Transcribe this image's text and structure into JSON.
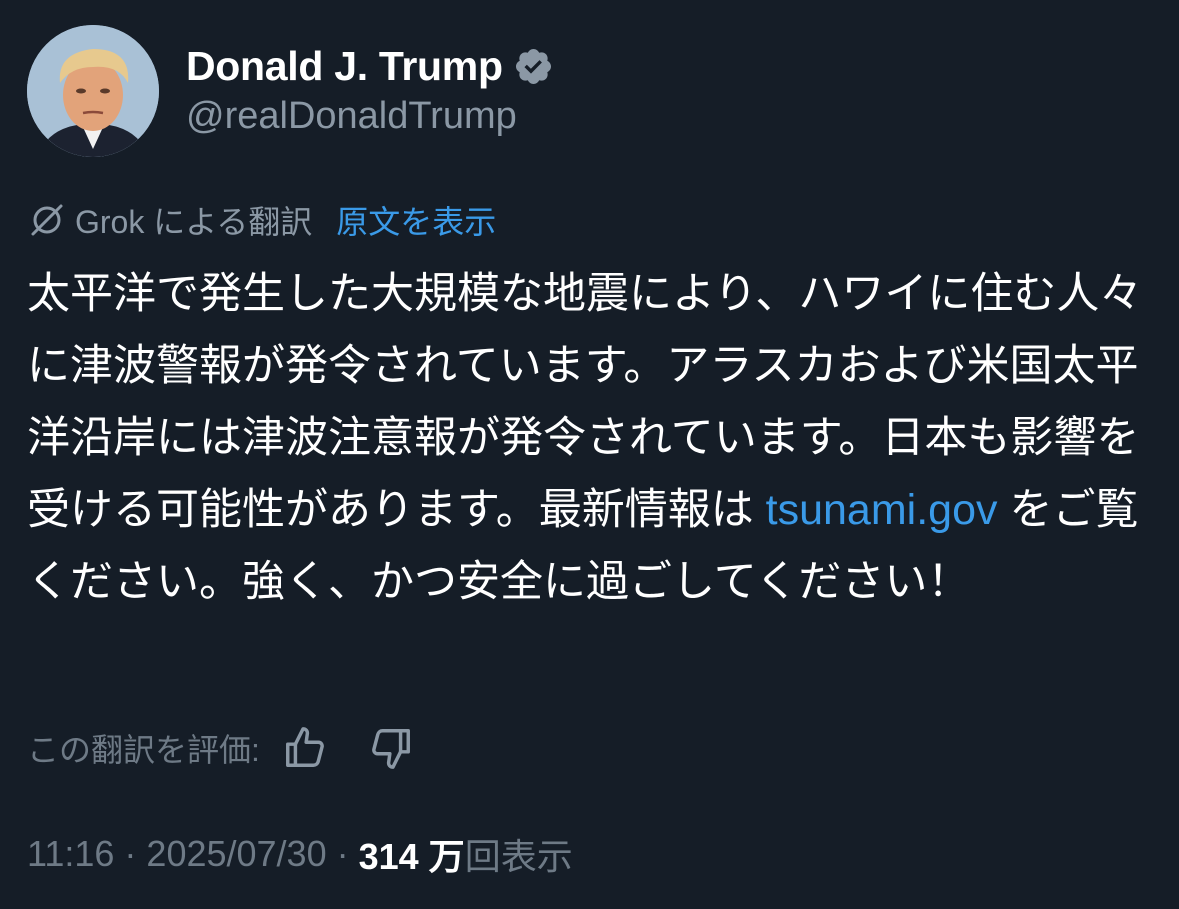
{
  "user": {
    "display_name": "Donald J. Trump",
    "handle": "@realDonaldTrump",
    "verified_icon": "verified-badge-icon",
    "verified_color": "#8b98a5"
  },
  "translation": {
    "label": "Grok による翻訳",
    "show_original": "原文を表示"
  },
  "tweet": {
    "text_before": "太平洋で発生した大規模な地震により、ハワイに住む人々に津波警報が発令されています。アラスカおよび米国太平洋沿岸には津波注意報が発令されています。日本も影響を受ける可能性があります。最新情報は ",
    "link": "tsunami.gov",
    "text_after": " をご覧ください。強く、かつ安全に過ごしてください！"
  },
  "rating": {
    "label": "この翻訳を評価:"
  },
  "meta": {
    "time": "11:16",
    "separator": " · ",
    "date": "2025/07/30",
    "views_count": "314 万",
    "views_label": "回表示"
  },
  "colors": {
    "background": "#151d27",
    "link": "#3a9ae8",
    "muted": "#8b98a5"
  }
}
